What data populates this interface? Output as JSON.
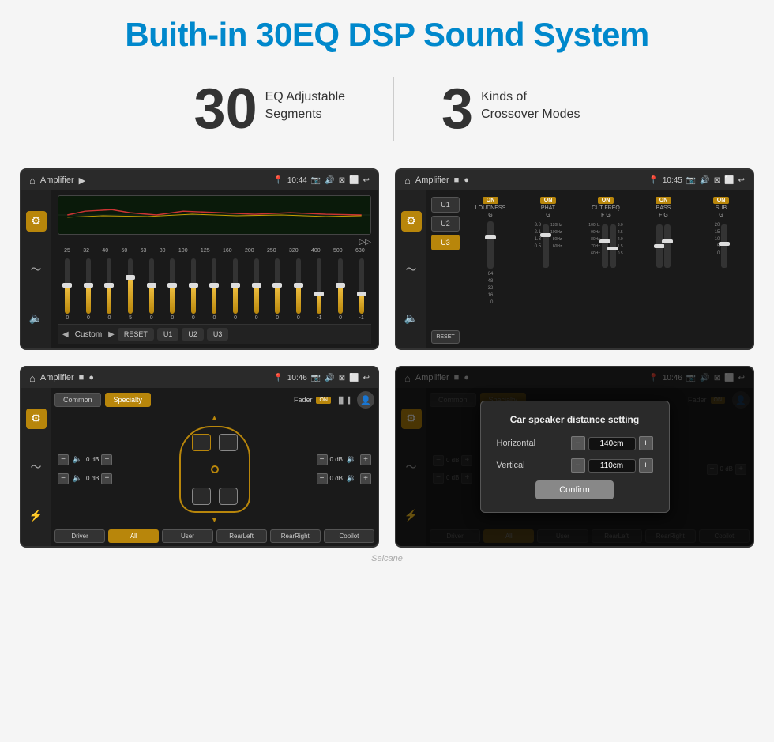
{
  "header": {
    "title": "Buith-in 30EQ DSP Sound System"
  },
  "stats": [
    {
      "number": "30",
      "desc": "EQ Adjustable\nSegments"
    },
    {
      "number": "3",
      "desc": "Kinds of\nCrossover Modes"
    }
  ],
  "screen1": {
    "title": "Amplifier",
    "time": "10:44",
    "eq_freqs": [
      "25",
      "32",
      "40",
      "50",
      "63",
      "80",
      "100",
      "125",
      "160",
      "200",
      "250",
      "320",
      "400",
      "500",
      "630"
    ],
    "eq_vals": [
      "0",
      "0",
      "0",
      "5",
      "0",
      "0",
      "0",
      "0",
      "0",
      "0",
      "0",
      "0",
      "-1",
      "0",
      "-1"
    ],
    "eq_heights": [
      50,
      50,
      50,
      65,
      50,
      50,
      50,
      50,
      50,
      50,
      50,
      50,
      35,
      50,
      35
    ],
    "eq_thumbs": [
      50,
      50,
      50,
      65,
      50,
      50,
      50,
      50,
      50,
      50,
      50,
      50,
      35,
      50,
      35
    ],
    "presets": [
      "Custom",
      "RESET",
      "U1",
      "U2",
      "U3"
    ]
  },
  "screen2": {
    "title": "Amplifier",
    "time": "10:45",
    "presets": [
      "U1",
      "U2",
      "U3"
    ],
    "active_preset": "U3",
    "channels": [
      {
        "name": "LOUDNESS",
        "on": true,
        "label": "G"
      },
      {
        "name": "PHAT",
        "on": true,
        "label": "G"
      },
      {
        "name": "CUT FREQ",
        "on": true,
        "label": "F G"
      },
      {
        "name": "BASS",
        "on": true,
        "label": "F G"
      },
      {
        "name": "SUB",
        "on": true,
        "label": "G"
      }
    ],
    "reset_label": "RESET"
  },
  "screen3": {
    "title": "Amplifier",
    "time": "10:46",
    "tabs": [
      "Common",
      "Specialty"
    ],
    "active_tab": "Specialty",
    "fader_label": "Fader",
    "fader_on": "ON",
    "db_values": [
      "0 dB",
      "0 dB",
      "0 dB",
      "0 dB"
    ],
    "bottom_btns": [
      "Driver",
      "RearLeft",
      "All",
      "User",
      "RearRight",
      "Copilot"
    ]
  },
  "screen4": {
    "title": "Amplifier",
    "time": "10:46",
    "dialog": {
      "title": "Car speaker distance setting",
      "horizontal_label": "Horizontal",
      "horizontal_value": "140cm",
      "vertical_label": "Vertical",
      "vertical_value": "110cm",
      "confirm_label": "Confirm"
    },
    "bottom_btns": [
      "Driver",
      "RearLeft",
      "All",
      "User",
      "RearRight",
      "Copilot"
    ]
  },
  "watermark": "Seicane"
}
